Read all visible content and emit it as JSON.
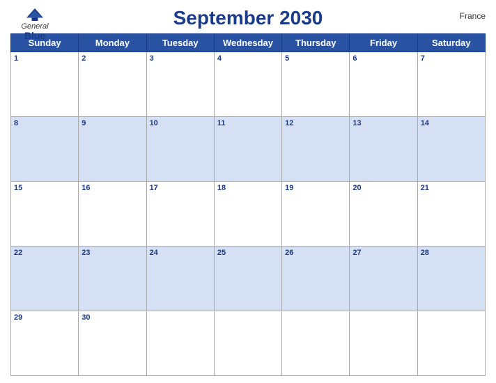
{
  "header": {
    "title": "September 2030",
    "country": "France",
    "logo_general": "General",
    "logo_blue": "Blue"
  },
  "days_of_week": [
    "Sunday",
    "Monday",
    "Tuesday",
    "Wednesday",
    "Thursday",
    "Friday",
    "Saturday"
  ],
  "weeks": [
    {
      "colored": false,
      "days": [
        {
          "num": "1",
          "active": true
        },
        {
          "num": "2",
          "active": true
        },
        {
          "num": "3",
          "active": true
        },
        {
          "num": "4",
          "active": true
        },
        {
          "num": "5",
          "active": true
        },
        {
          "num": "6",
          "active": true
        },
        {
          "num": "7",
          "active": true
        }
      ]
    },
    {
      "colored": true,
      "days": [
        {
          "num": "8",
          "active": true
        },
        {
          "num": "9",
          "active": true
        },
        {
          "num": "10",
          "active": true
        },
        {
          "num": "11",
          "active": true
        },
        {
          "num": "12",
          "active": true
        },
        {
          "num": "13",
          "active": true
        },
        {
          "num": "14",
          "active": true
        }
      ]
    },
    {
      "colored": false,
      "days": [
        {
          "num": "15",
          "active": true
        },
        {
          "num": "16",
          "active": true
        },
        {
          "num": "17",
          "active": true
        },
        {
          "num": "18",
          "active": true
        },
        {
          "num": "19",
          "active": true
        },
        {
          "num": "20",
          "active": true
        },
        {
          "num": "21",
          "active": true
        }
      ]
    },
    {
      "colored": true,
      "days": [
        {
          "num": "22",
          "active": true
        },
        {
          "num": "23",
          "active": true
        },
        {
          "num": "24",
          "active": true
        },
        {
          "num": "25",
          "active": true
        },
        {
          "num": "26",
          "active": true
        },
        {
          "num": "27",
          "active": true
        },
        {
          "num": "28",
          "active": true
        }
      ]
    },
    {
      "colored": false,
      "days": [
        {
          "num": "29",
          "active": true
        },
        {
          "num": "30",
          "active": true
        },
        {
          "num": "",
          "active": false
        },
        {
          "num": "",
          "active": false
        },
        {
          "num": "",
          "active": false
        },
        {
          "num": "",
          "active": false
        },
        {
          "num": "",
          "active": false
        }
      ]
    }
  ]
}
